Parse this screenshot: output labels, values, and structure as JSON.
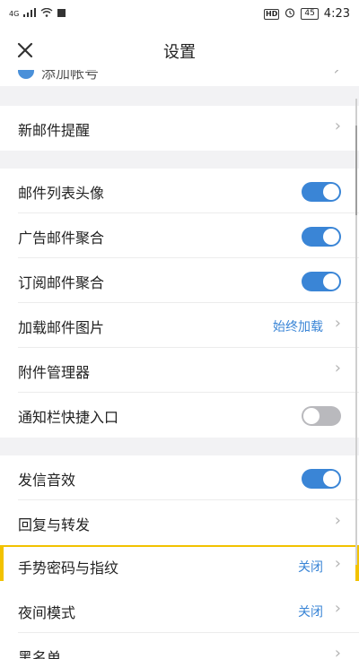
{
  "status_bar": {
    "network": "4G",
    "hd": "HD",
    "battery": "45",
    "time": "4:23",
    "icons": [
      "signal-icon",
      "wifi-icon",
      "notification-icon",
      "alarm-icon",
      "battery-icon"
    ]
  },
  "header": {
    "close_icon": "close-icon",
    "title": "设置"
  },
  "partial_item": {
    "label": "添加帐号"
  },
  "settings": {
    "new_mail_alert": {
      "label": "新邮件提醒"
    },
    "list_avatar": {
      "label": "邮件列表头像",
      "enabled": true
    },
    "ad_aggregation": {
      "label": "广告邮件聚合",
      "enabled": true
    },
    "subscription_aggregation": {
      "label": "订阅邮件聚合",
      "enabled": true
    },
    "load_images": {
      "label": "加载邮件图片",
      "value": "始终加载"
    },
    "attachment_manager": {
      "label": "附件管理器"
    },
    "notification_shortcut": {
      "label": "通知栏快捷入口",
      "enabled": false
    },
    "send_sound": {
      "label": "发信音效",
      "enabled": true
    },
    "reply_forward": {
      "label": "回复与转发"
    },
    "gesture_password": {
      "label": "手势密码与指纹",
      "value": "关闭"
    },
    "night_mode": {
      "label": "夜间模式",
      "value": "关闭"
    },
    "blacklist": {
      "label": "黑名单"
    }
  },
  "colors": {
    "accent": "#3a85d6",
    "toggle_off": "#b9b9bd",
    "highlight": "#f2c200",
    "section_background": "#f2f2f4"
  }
}
